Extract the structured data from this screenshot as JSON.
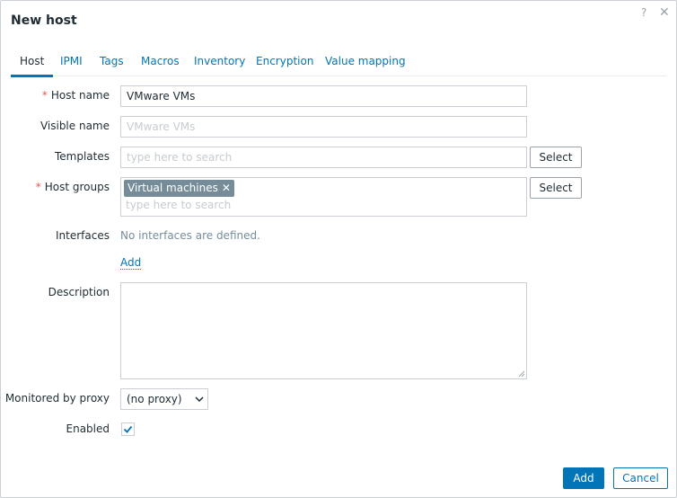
{
  "dialog": {
    "title": "New host",
    "help_glyph": "?",
    "close_glyph": "✕"
  },
  "tabs": [
    {
      "label": "Host"
    },
    {
      "label": "IPMI"
    },
    {
      "label": "Tags"
    },
    {
      "label": "Macros"
    },
    {
      "label": "Inventory"
    },
    {
      "label": "Encryption"
    },
    {
      "label": "Value mapping"
    }
  ],
  "form": {
    "required_marker": "*",
    "host_name": {
      "label": "Host name",
      "value": "VMware VMs"
    },
    "visible_name": {
      "label": "Visible name",
      "placeholder": "VMware VMs"
    },
    "templates": {
      "label": "Templates",
      "placeholder": "type here to search",
      "select_label": "Select"
    },
    "host_groups": {
      "label": "Host groups",
      "chips": [
        {
          "label": "Virtual machines",
          "remove_glyph": "✕"
        }
      ],
      "placeholder": "type here to search",
      "select_label": "Select"
    },
    "interfaces": {
      "label": "Interfaces",
      "empty_text": "No interfaces are defined.",
      "add_label": "Add"
    },
    "description": {
      "label": "Description",
      "value": ""
    },
    "proxy": {
      "label": "Monitored by proxy",
      "selected": "(no proxy)"
    },
    "enabled": {
      "label": "Enabled",
      "checked": true
    }
  },
  "footer": {
    "add_label": "Add",
    "cancel_label": "Cancel"
  },
  "colors": {
    "accent": "#0275b8",
    "required": "#e45959",
    "chip": "#768d99"
  }
}
